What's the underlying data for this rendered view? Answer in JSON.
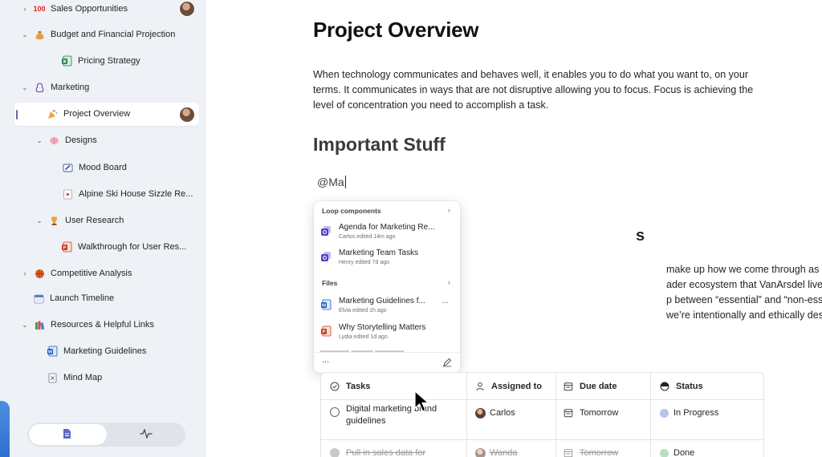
{
  "sidebar": {
    "items": [
      {
        "label": "Sales Opportunities",
        "icon": "hundred-points-emoji"
      },
      {
        "label": "Budget and Financial Projection",
        "icon": "money-bag-emoji"
      },
      {
        "label": "Pricing Strategy",
        "icon": "excel-file-icon"
      },
      {
        "label": "Marketing",
        "icon": "marketing-emoji"
      },
      {
        "label": "Project Overview",
        "icon": "party-popper-emoji"
      },
      {
        "label": "Designs",
        "icon": "brain-emoji"
      },
      {
        "label": "Mood Board",
        "icon": "whiteboard-icon"
      },
      {
        "label": "Alpine Ski House Sizzle Re...",
        "icon": "video-file-icon"
      },
      {
        "label": "User Research",
        "icon": "trophy-emoji"
      },
      {
        "label": "Walkthrough for User Res...",
        "icon": "powerpoint-file-icon"
      },
      {
        "label": "Competitive Analysis",
        "icon": "basketball-emoji"
      },
      {
        "label": "Launch Timeline",
        "icon": "calendar-emoji"
      },
      {
        "label": "Resources & Helpful Links",
        "icon": "books-emoji"
      },
      {
        "label": "Marketing Guidelines",
        "icon": "word-file-icon"
      },
      {
        "label": "Mind Map",
        "icon": "mind-map-file-icon"
      }
    ]
  },
  "page": {
    "title": "Project Overview",
    "intro": "When technology communicates and behaves well, it enables you to do what you want to, on your terms. It communicates in ways that are not disruptive allowing you to focus. Focus is achieving the level of concentration you need to accomplish a task.",
    "section_heading": "Important Stuff",
    "mention_text": "@Ma",
    "hidden_heading_fragment": "s",
    "hidden_para_lines": [
      "make up how we come through as VanArsdel. We’re crafting experi-",
      "ader ecosystem that VanArsdel lives within. As the world wakes up to",
      "p between “essential” and “non-essential” workers, and the long-term",
      "we’re intentionally and ethically designing digital spaces to support a"
    ]
  },
  "popup": {
    "loop_header": "Loop components",
    "files_header": "Files",
    "loop_items": [
      {
        "title": "Agenda for Marketing Re...",
        "sub": "Carlos edited 14m ago"
      },
      {
        "title": "Marketing Team Tasks",
        "sub": "Henry edited 7d ago"
      }
    ],
    "file_items": [
      {
        "title": "Marketing Guidelines f...",
        "sub": "Elvia edited 1h ago",
        "more": "..."
      },
      {
        "title": "Why Storytelling Matters",
        "sub": "Lydia edited 1d ago"
      }
    ],
    "footer_dots": "..."
  },
  "table": {
    "headers": {
      "tasks": "Tasks",
      "assigned": "Assigned to",
      "due": "Due date",
      "status": "Status"
    },
    "rows": [
      {
        "task_line1": "Digital marketing brand",
        "task_line2": "guidelines",
        "assigned": "Carlos",
        "due": "Tomorrow",
        "status": "In Progress",
        "status_color": "#b9c3f0"
      },
      {
        "task_line1": "Pull in sales data for",
        "assigned": "Wanda",
        "due": "Tomorrow",
        "status": "Done",
        "status_color": "#b7dfc0"
      }
    ]
  },
  "colors": {
    "sidebar_bg": "#eef1f6",
    "accent": "#2f6fd0"
  }
}
